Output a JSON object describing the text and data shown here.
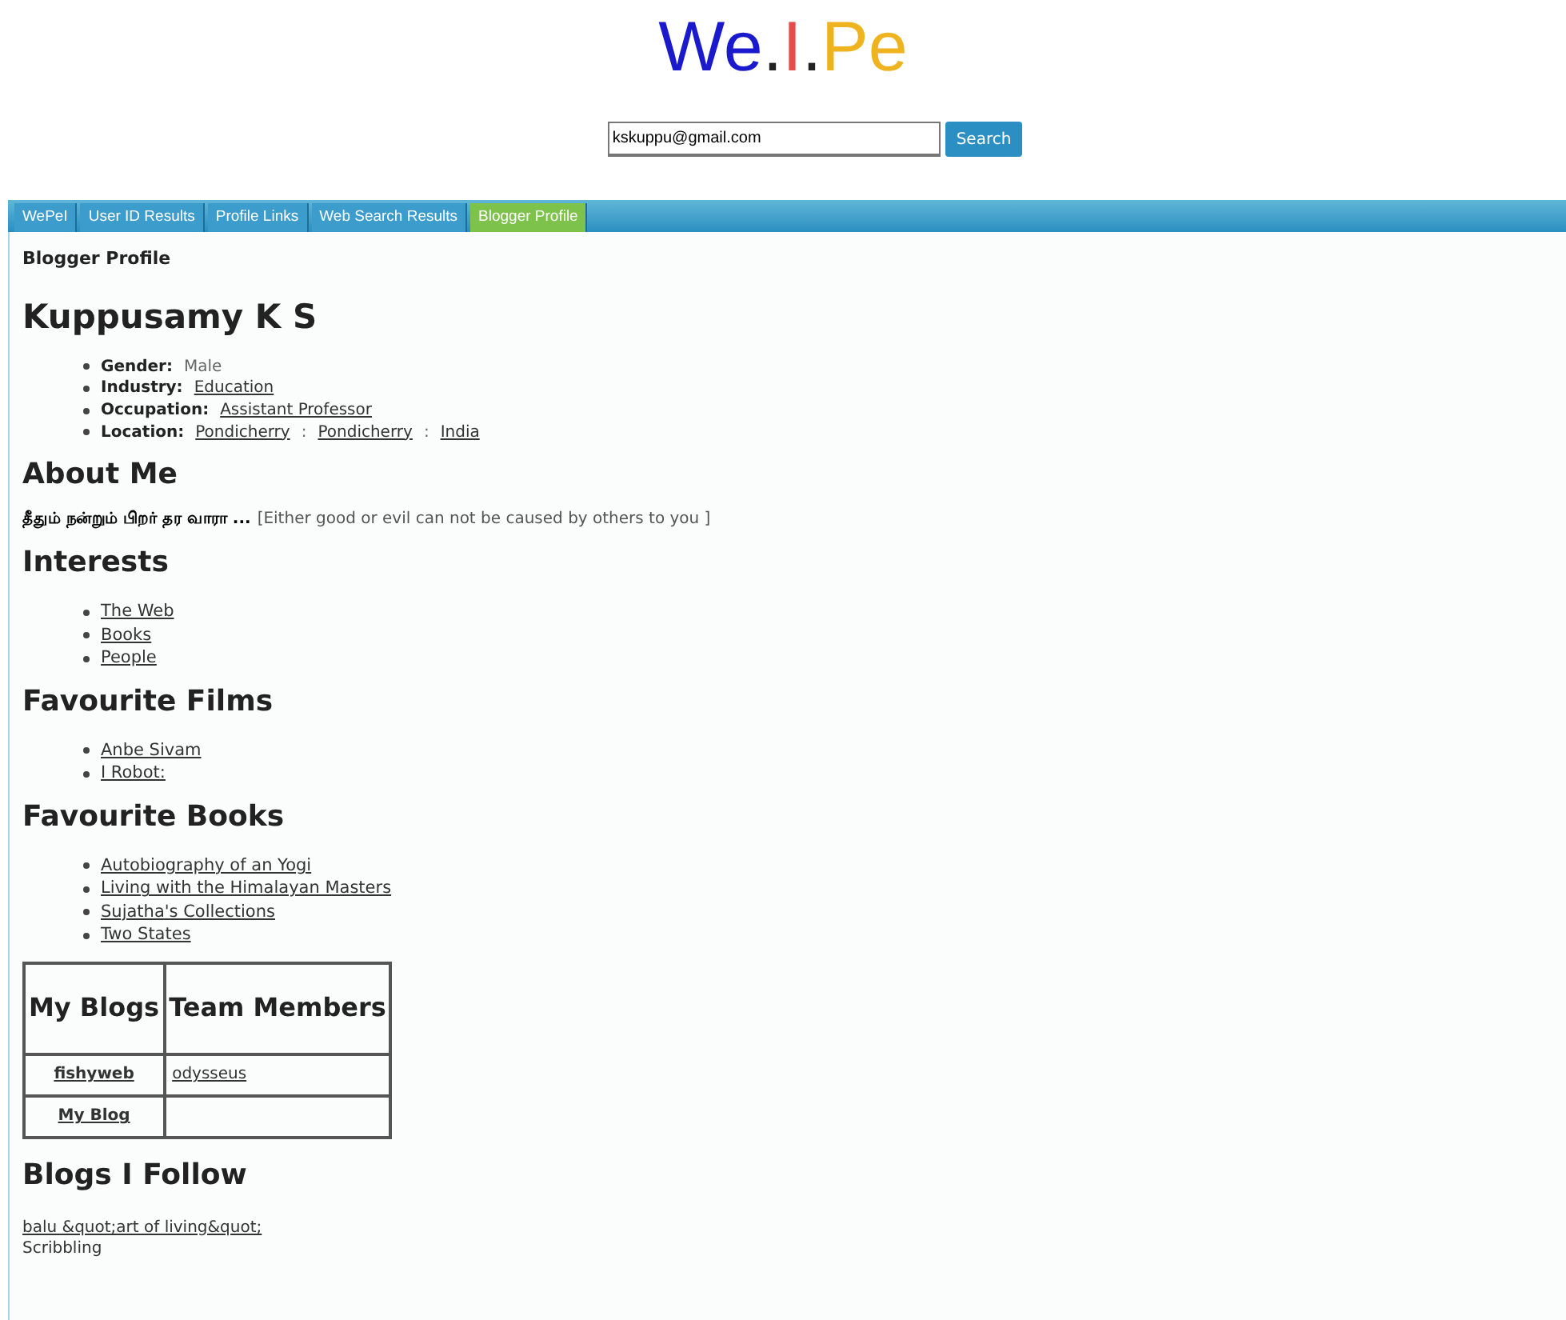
{
  "logo": [
    {
      "text": "We",
      "color": "#1a1acc"
    },
    {
      "text": ".",
      "color": "#222222"
    },
    {
      "text": "I",
      "color": "#e84a4a"
    },
    {
      "text": ".",
      "color": "#222222"
    },
    {
      "text": "Pe",
      "color": "#efb320"
    }
  ],
  "search": {
    "value": "kskuppu@gmail.com",
    "button": "Search"
  },
  "tabs": [
    {
      "label": "WePeI",
      "selected": false
    },
    {
      "label": "User ID Results",
      "selected": false
    },
    {
      "label": "Profile Links",
      "selected": false
    },
    {
      "label": "Web Search Results",
      "selected": false
    },
    {
      "label": "Blogger Profile",
      "selected": true
    }
  ],
  "page_title": "Blogger Profile",
  "name": "Kuppusamy K S",
  "details": [
    {
      "label": "Gender:",
      "values": [
        {
          "text": "Male",
          "kind": "text"
        }
      ]
    },
    {
      "label": "Industry:",
      "values": [
        {
          "text": "Education",
          "kind": "link"
        }
      ]
    },
    {
      "label": "Occupation:",
      "values": [
        {
          "text": "Assistant Professor",
          "kind": "link"
        }
      ]
    },
    {
      "label": "Location:",
      "separator": ":",
      "values": [
        {
          "text": "Pondicherry",
          "kind": "link"
        },
        {
          "text": "Pondicherry",
          "kind": "link"
        },
        {
          "text": "India",
          "kind": "link"
        }
      ]
    }
  ],
  "about": {
    "heading": "About Me",
    "quote": "தீதும் நன்றும் பிறர் தர வாரா ...",
    "translation": "[Either good or evil can not be caused by others to you ]"
  },
  "interests": {
    "heading": "Interests",
    "items": [
      "The Web",
      "Books",
      "People"
    ]
  },
  "films": {
    "heading": "Favourite Films",
    "items": [
      "Anbe Sivam",
      "I Robot:"
    ]
  },
  "books": {
    "heading": "Favourite Books",
    "items": [
      "Autobiography of an Yogi",
      "Living with the Himalayan Masters",
      "Sujatha's Collections",
      "Two States"
    ]
  },
  "blogs_table": {
    "columns": [
      "My Blogs",
      "Team Members"
    ],
    "rows": [
      [
        "fishyweb",
        "odysseus"
      ],
      [
        "My Blog",
        ""
      ]
    ]
  },
  "follow": {
    "heading": "Blogs I Follow",
    "items": [
      {
        "text": "balu &quot;art of living&quot;",
        "kind": "link"
      },
      {
        "text": "Scribbling",
        "kind": "text"
      }
    ]
  }
}
